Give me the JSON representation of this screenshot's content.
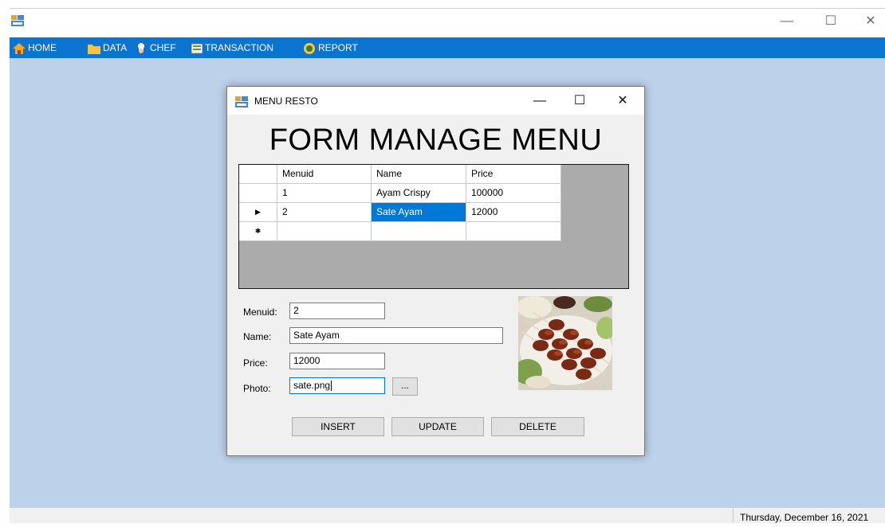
{
  "window": {
    "app_icon": "form-app-icon",
    "controls": {
      "minimize": "—",
      "maximize": "☐",
      "close": "✕"
    }
  },
  "menu": [
    {
      "label": "HOME",
      "icon": "home-icon"
    },
    {
      "label": "DATA",
      "icon": "folder-icon"
    },
    {
      "label": "CHEF",
      "icon": "chef-icon"
    },
    {
      "label": "TRANSACTION",
      "icon": "transaction-icon"
    },
    {
      "label": "REPORT",
      "icon": "report-icon"
    }
  ],
  "child": {
    "title": "MENU RESTO",
    "heading": "FORM MANAGE MENU",
    "grid": {
      "columns": [
        "Menuid",
        "Name",
        "Price"
      ],
      "rows": [
        {
          "marker": "",
          "cells": [
            "1",
            "Ayam Crispy",
            "100000"
          ]
        },
        {
          "marker": "▶",
          "cells": [
            "2",
            "Sate Ayam",
            "12000"
          ]
        },
        {
          "marker": "✱",
          "cells": [
            "",
            "",
            ""
          ]
        }
      ],
      "selected_cell": "Sate Ayam"
    },
    "fields": {
      "menuid_label": "Menuid:",
      "menuid_value": "2",
      "name_label": "Name:",
      "name_value": "Sate Ayam",
      "price_label": "Price:",
      "price_value": "12000",
      "photo_label": "Photo:",
      "photo_value": "sate.png",
      "browse_label": "..."
    },
    "buttons": {
      "insert": "INSERT",
      "update": "UPDATE",
      "delete": "DELETE"
    },
    "photo_icon": "sate-photo"
  },
  "status": {
    "date": "Thursday, December 16, 2021"
  },
  "colors": {
    "menubar": "#0a74d0",
    "mdi_background": "#bcd1ea",
    "selection": "#0078d7"
  }
}
